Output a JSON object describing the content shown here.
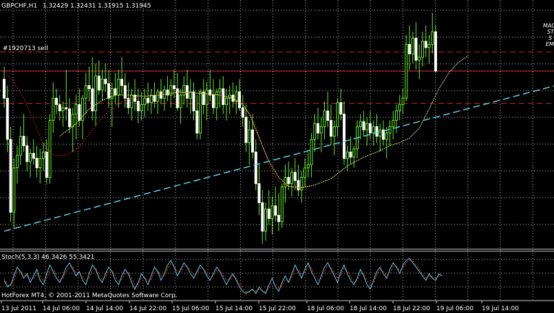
{
  "chart_data": {
    "type": "candlestick",
    "symbol": "GBPCHF,H1",
    "quote": "1.32429 1.32431 1.31915 1.31945",
    "order_label": "#1920713 sell",
    "copyright": "HotForex MT4, © 2001-2011 MetaQuotes Software Corp.",
    "corner_labels": [
      "MAC",
      "ST",
      "S",
      "EM"
    ],
    "x_ticks": [
      "13 Jul 2011",
      "14 Jul 06:00",
      "14 Jul 14:00",
      "14 Jul 22:00",
      "15 Jul 06:00",
      "15 Jul 14:00",
      "15 Jul 22:00",
      "18 Jul 06:00",
      "18 Jul 14:00",
      "18 Jul 22:00",
      "19 Jul 06:00",
      "19 Jul 14:00"
    ],
    "y_range": [
      1.2952,
      1.3325
    ],
    "horizontal_levels": [
      {
        "value": 1.3258,
        "style": "dashed",
        "color": "#cc2222"
      },
      {
        "value": 1.3228,
        "style": "solid",
        "color": "#dd3333"
      },
      {
        "value": 1.3177,
        "style": "dashed",
        "color": "#cc2222"
      }
    ],
    "trendline": {
      "from": [
        0,
        1.2975
      ],
      "to": [
        154,
        1.3185
      ],
      "color": "#5fd3e8"
    },
    "candles": [
      [
        1.3215,
        1.3235,
        1.317,
        1.3185
      ],
      [
        1.3185,
        1.3205,
        1.31,
        1.312
      ],
      [
        1.312,
        1.314,
        1.299,
        1.3005
      ],
      [
        1.3005,
        1.309,
        1.298,
        1.3075
      ],
      [
        1.3075,
        1.311,
        1.305,
        1.3095
      ],
      [
        1.3095,
        1.314,
        1.308,
        1.3125
      ],
      [
        1.3125,
        1.316,
        1.31,
        1.311
      ],
      [
        1.311,
        1.3125,
        1.307,
        1.3085
      ],
      [
        1.3085,
        1.3105,
        1.306,
        1.3098
      ],
      [
        1.3098,
        1.312,
        1.308,
        1.309
      ],
      [
        1.309,
        1.311,
        1.306,
        1.3075
      ],
      [
        1.3075,
        1.3105,
        1.305,
        1.309
      ],
      [
        1.309,
        1.3115,
        1.307,
        1.31
      ],
      [
        1.31,
        1.312,
        1.305,
        1.306
      ],
      [
        1.306,
        1.316,
        1.305,
        1.315
      ],
      [
        1.315,
        1.321,
        1.313,
        1.3185
      ],
      [
        1.3185,
        1.32,
        1.316,
        1.3175
      ],
      [
        1.3175,
        1.319,
        1.315,
        1.3165
      ],
      [
        1.3165,
        1.318,
        1.314,
        1.317
      ],
      [
        1.317,
        1.323,
        1.315,
        1.3168
      ],
      [
        1.3168,
        1.3185,
        1.313,
        1.314
      ],
      [
        1.314,
        1.317,
        1.31,
        1.316
      ],
      [
        1.316,
        1.319,
        1.312,
        1.3175
      ],
      [
        1.3175,
        1.32,
        1.314,
        1.315
      ],
      [
        1.315,
        1.319,
        1.312,
        1.3185
      ],
      [
        1.3185,
        1.3225,
        1.316,
        1.3205
      ],
      [
        1.3205,
        1.3235,
        1.318,
        1.32
      ],
      [
        1.32,
        1.325,
        1.315,
        1.3165
      ],
      [
        1.3165,
        1.324,
        1.314,
        1.322
      ],
      [
        1.322,
        1.3245,
        1.319,
        1.3198
      ],
      [
        1.3198,
        1.323,
        1.318,
        1.3215
      ],
      [
        1.3215,
        1.324,
        1.3195,
        1.3208
      ],
      [
        1.3208,
        1.323,
        1.317,
        1.3185
      ],
      [
        1.3185,
        1.321,
        1.314,
        1.32
      ],
      [
        1.32,
        1.3225,
        1.3175,
        1.319
      ],
      [
        1.319,
        1.323,
        1.317,
        1.3215
      ],
      [
        1.3215,
        1.325,
        1.319,
        1.3205
      ],
      [
        1.3205,
        1.3225,
        1.317,
        1.3185
      ],
      [
        1.3185,
        1.321,
        1.316,
        1.317
      ],
      [
        1.317,
        1.32,
        1.315,
        1.319
      ],
      [
        1.319,
        1.3215,
        1.3165,
        1.318
      ],
      [
        1.318,
        1.32,
        1.3145,
        1.3165
      ],
      [
        1.3165,
        1.3195,
        1.315,
        1.3175
      ],
      [
        1.3175,
        1.32,
        1.3155,
        1.3185
      ],
      [
        1.3185,
        1.321,
        1.3165,
        1.3178
      ],
      [
        1.3178,
        1.32,
        1.316,
        1.319
      ],
      [
        1.319,
        1.321,
        1.317,
        1.318
      ],
      [
        1.318,
        1.32,
        1.316,
        1.3195
      ],
      [
        1.3195,
        1.3215,
        1.3175,
        1.3185
      ],
      [
        1.3185,
        1.3205,
        1.3165,
        1.3198
      ],
      [
        1.3198,
        1.322,
        1.318,
        1.319
      ],
      [
        1.319,
        1.3215,
        1.317,
        1.3205
      ],
      [
        1.3205,
        1.323,
        1.3185,
        1.32
      ],
      [
        1.32,
        1.3225,
        1.3165,
        1.317
      ],
      [
        1.317,
        1.32,
        1.3145,
        1.319
      ],
      [
        1.319,
        1.322,
        1.3175,
        1.3205
      ],
      [
        1.3205,
        1.323,
        1.317,
        1.3185
      ],
      [
        1.3185,
        1.3215,
        1.316,
        1.3195
      ],
      [
        1.3195,
        1.321,
        1.315,
        1.3165
      ],
      [
        1.3165,
        1.319,
        1.312,
        1.313
      ],
      [
        1.313,
        1.32,
        1.312,
        1.3195
      ],
      [
        1.3195,
        1.3215,
        1.316,
        1.3175
      ],
      [
        1.3175,
        1.321,
        1.315,
        1.3198
      ],
      [
        1.3198,
        1.323,
        1.318,
        1.319
      ],
      [
        1.319,
        1.3215,
        1.316,
        1.317
      ],
      [
        1.317,
        1.32,
        1.315,
        1.3195
      ],
      [
        1.3195,
        1.3215,
        1.317,
        1.32
      ],
      [
        1.32,
        1.322,
        1.316,
        1.3175
      ],
      [
        1.3175,
        1.32,
        1.315,
        1.3185
      ],
      [
        1.3185,
        1.3205,
        1.316,
        1.319
      ],
      [
        1.319,
        1.321,
        1.317,
        1.318
      ],
      [
        1.318,
        1.3205,
        1.316,
        1.3195
      ],
      [
        1.3195,
        1.3215,
        1.3165,
        1.317
      ],
      [
        1.317,
        1.319,
        1.314,
        1.3155
      ],
      [
        1.3155,
        1.3175,
        1.31,
        1.3115
      ],
      [
        1.3115,
        1.315,
        1.308,
        1.3135
      ],
      [
        1.3135,
        1.316,
        1.309,
        1.31
      ],
      [
        1.31,
        1.312,
        1.304,
        1.305
      ],
      [
        1.305,
        1.308,
        1.3,
        1.302
      ],
      [
        1.302,
        1.304,
        1.2955,
        1.2975
      ],
      [
        1.2975,
        1.302,
        1.296,
        1.301
      ],
      [
        1.301,
        1.304,
        1.2985,
        1.2995
      ],
      [
        1.2995,
        1.303,
        1.297,
        1.3015
      ],
      [
        1.3015,
        1.3045,
        1.299,
        1.3
      ],
      [
        1.3,
        1.3035,
        1.2975,
        1.299
      ],
      [
        1.299,
        1.305,
        1.298,
        1.3045
      ],
      [
        1.3045,
        1.308,
        1.302,
        1.306
      ],
      [
        1.306,
        1.3085,
        1.304,
        1.305
      ],
      [
        1.305,
        1.3075,
        1.303,
        1.3068
      ],
      [
        1.3068,
        1.309,
        1.304,
        1.3055
      ],
      [
        1.3055,
        1.308,
        1.303,
        1.304
      ],
      [
        1.304,
        1.307,
        1.302,
        1.306
      ],
      [
        1.306,
        1.309,
        1.3045,
        1.3075
      ],
      [
        1.3075,
        1.31,
        1.306,
        1.308
      ],
      [
        1.308,
        1.313,
        1.306,
        1.312
      ],
      [
        1.312,
        1.316,
        1.31,
        1.3145
      ],
      [
        1.3145,
        1.317,
        1.312,
        1.313
      ],
      [
        1.313,
        1.3155,
        1.31,
        1.314
      ],
      [
        1.314,
        1.318,
        1.312,
        1.3165
      ],
      [
        1.3165,
        1.3195,
        1.314,
        1.315
      ],
      [
        1.315,
        1.3175,
        1.311,
        1.3125
      ],
      [
        1.3125,
        1.315,
        1.3095,
        1.314
      ],
      [
        1.314,
        1.3185,
        1.3125,
        1.3178
      ],
      [
        1.3178,
        1.32,
        1.315,
        1.316
      ],
      [
        1.316,
        1.318,
        1.308,
        1.309
      ],
      [
        1.309,
        1.311,
        1.307,
        1.31
      ],
      [
        1.31,
        1.3125,
        1.308,
        1.3092
      ],
      [
        1.3092,
        1.311,
        1.3075,
        1.3105
      ],
      [
        1.3105,
        1.315,
        1.309,
        1.314
      ],
      [
        1.314,
        1.316,
        1.312,
        1.3148
      ],
      [
        1.3148,
        1.3165,
        1.3125,
        1.3135
      ],
      [
        1.3135,
        1.3155,
        1.311,
        1.3145
      ],
      [
        1.3145,
        1.3165,
        1.312,
        1.313
      ],
      [
        1.313,
        1.315,
        1.311,
        1.314
      ],
      [
        1.314,
        1.316,
        1.3115,
        1.3125
      ],
      [
        1.3125,
        1.3145,
        1.31,
        1.3135
      ],
      [
        1.3135,
        1.315,
        1.311,
        1.312
      ],
      [
        1.312,
        1.314,
        1.309,
        1.313
      ],
      [
        1.313,
        1.315,
        1.311,
        1.314
      ],
      [
        1.314,
        1.3165,
        1.312,
        1.315
      ],
      [
        1.315,
        1.3175,
        1.313,
        1.3165
      ],
      [
        1.3165,
        1.319,
        1.315,
        1.3175
      ],
      [
        1.3175,
        1.32,
        1.316,
        1.3185
      ],
      [
        1.3185,
        1.3285,
        1.318,
        1.327
      ],
      [
        1.327,
        1.33,
        1.323,
        1.3255
      ],
      [
        1.3255,
        1.329,
        1.324,
        1.328
      ],
      [
        1.328,
        1.3305,
        1.323,
        1.3245
      ],
      [
        1.3245,
        1.327,
        1.3215,
        1.325
      ],
      [
        1.325,
        1.329,
        1.3235,
        1.3275
      ],
      [
        1.3275,
        1.33,
        1.325,
        1.3265
      ],
      [
        1.3265,
        1.3285,
        1.324,
        1.327
      ],
      [
        1.327,
        1.332,
        1.3255,
        1.329
      ],
      [
        1.329,
        1.33,
        1.3225,
        1.3228
      ]
    ],
    "ma_fast": [
      [
        17,
        1.3125
      ],
      [
        22,
        1.3145
      ],
      [
        26,
        1.3168
      ],
      [
        30,
        1.3182
      ],
      [
        34,
        1.319
      ],
      [
        38,
        1.319
      ],
      [
        43,
        1.3188
      ],
      [
        48,
        1.319
      ],
      [
        53,
        1.3195
      ],
      [
        57,
        1.3194
      ],
      [
        62,
        1.3192
      ],
      [
        66,
        1.319
      ],
      [
        70,
        1.3185
      ],
      [
        73,
        1.3175
      ],
      [
        75,
        1.316
      ],
      [
        77,
        1.3135
      ],
      [
        79,
        1.311
      ],
      [
        81,
        1.3085
      ],
      [
        84,
        1.306
      ],
      [
        87,
        1.3046
      ],
      [
        91,
        1.3044
      ],
      [
        95,
        1.3048
      ],
      [
        100,
        1.3058
      ],
      [
        105,
        1.3078
      ],
      [
        110,
        1.3092
      ],
      [
        114,
        1.31
      ],
      [
        118,
        1.311
      ],
      [
        121,
        1.3115
      ],
      [
        124,
        1.3122
      ],
      [
        127,
        1.3138
      ],
      [
        130,
        1.3168
      ],
      [
        133,
        1.32
      ],
      [
        136,
        1.3225
      ],
      [
        139,
        1.3242
      ],
      [
        142,
        1.3252
      ]
    ],
    "ma_slow": [
      [
        0,
        1.323
      ],
      [
        3,
        1.321
      ],
      [
        6,
        1.3185
      ],
      [
        9,
        1.315
      ],
      [
        12,
        1.3112
      ],
      [
        15,
        1.3095
      ],
      [
        19,
        1.3095
      ],
      [
        23,
        1.3108
      ],
      [
        27,
        1.3135
      ],
      [
        31,
        1.316
      ],
      [
        36,
        1.318
      ],
      [
        41,
        1.3188
      ],
      [
        46,
        1.319
      ],
      [
        51,
        1.3192
      ],
      [
        56,
        1.3194
      ],
      [
        61,
        1.3192
      ],
      [
        66,
        1.319
      ],
      [
        70,
        1.3185
      ],
      [
        73,
        1.3175
      ],
      [
        75,
        1.3162
      ],
      [
        77,
        1.314
      ],
      [
        79,
        1.311
      ],
      [
        81,
        1.308
      ],
      [
        83,
        1.3062
      ],
      [
        85,
        1.305
      ],
      [
        88,
        1.3044
      ],
      [
        91,
        1.3043
      ],
      [
        94,
        1.3046
      ]
    ],
    "stoch": {
      "label": "Stoch(5,3,3) 46.3426 55.3421",
      "ylim": [
        0,
        100
      ],
      "main": [
        40,
        25,
        30,
        50,
        70,
        60,
        45,
        55,
        35,
        50,
        65,
        40,
        30,
        55,
        75,
        60,
        45,
        35,
        50,
        70,
        80,
        65,
        50,
        60,
        40,
        30,
        55,
        75,
        65,
        45,
        35,
        55,
        70,
        60,
        40,
        30,
        50,
        65,
        55,
        35,
        20,
        35,
        55,
        45,
        30,
        50,
        70,
        60,
        40,
        55,
        75,
        85,
        70,
        50,
        65,
        80,
        70,
        55,
        45,
        60,
        75,
        65,
        50,
        40,
        55,
        70,
        60,
        45,
        30,
        45,
        55,
        40,
        25,
        15,
        10,
        15,
        20,
        10,
        25,
        15,
        10,
        30,
        45,
        25,
        15,
        35,
        50,
        35,
        55,
        75,
        60,
        45,
        65,
        80,
        60,
        45,
        30,
        50,
        70,
        80,
        65,
        50,
        35,
        60,
        75,
        55,
        40,
        30,
        45,
        65,
        50,
        30,
        20,
        40,
        60,
        70,
        55,
        45,
        65,
        80,
        70,
        55,
        75,
        85,
        90,
        80,
        70,
        60,
        50,
        40,
        55,
        45,
        40,
        55,
        50
      ],
      "signal": [
        45,
        30,
        28,
        40,
        60,
        62,
        52,
        50,
        45,
        45,
        55,
        50,
        38,
        45,
        62,
        65,
        55,
        42,
        45,
        60,
        72,
        70,
        58,
        55,
        50,
        38,
        45,
        62,
        68,
        55,
        42,
        48,
        62,
        62,
        50,
        38,
        42,
        55,
        58,
        45,
        30,
        30,
        45,
        48,
        38,
        42,
        58,
        62,
        50,
        50,
        65,
        78,
        75,
        60,
        60,
        72,
        72,
        62,
        52,
        55,
        68,
        66,
        56,
        46,
        50,
        62,
        62,
        52,
        40,
        42,
        50,
        45,
        32,
        22,
        14,
        13,
        17,
        15,
        20,
        18,
        14,
        22,
        35,
        32,
        22,
        28,
        42,
        38,
        47,
        65,
        65,
        55,
        58,
        72,
        68,
        54,
        40,
        44,
        60,
        74,
        70,
        58,
        44,
        52,
        68,
        62,
        48,
        36,
        40,
        56,
        54,
        40,
        28,
        34,
        52,
        64,
        60,
        50,
        56,
        72,
        72,
        62,
        68,
        80,
        86,
        84,
        75,
        65,
        55,
        46,
        50,
        48,
        44,
        50,
        52
      ]
    }
  }
}
